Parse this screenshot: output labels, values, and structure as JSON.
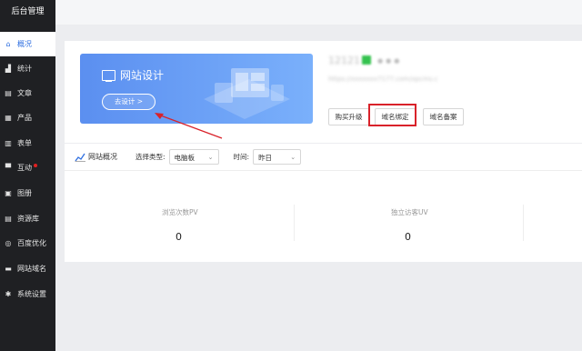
{
  "sidebar": {
    "title": "后台管理",
    "items": [
      {
        "label": "概况",
        "icon": "home-icon",
        "glyph": "⌂",
        "active": true
      },
      {
        "label": "统计",
        "icon": "stats-icon",
        "glyph": "▟"
      },
      {
        "label": "文章",
        "icon": "article-icon",
        "glyph": "▤"
      },
      {
        "label": "产品",
        "icon": "product-icon",
        "glyph": "▦"
      },
      {
        "label": "表单",
        "icon": "form-icon",
        "glyph": "▥"
      },
      {
        "label": "互动",
        "icon": "interaction-icon",
        "glyph": "▀",
        "badge": true
      },
      {
        "label": "图册",
        "icon": "gallery-icon",
        "glyph": "▣"
      },
      {
        "label": "资源库",
        "icon": "library-icon",
        "glyph": "▤"
      },
      {
        "label": "百度优化",
        "icon": "seo-icon",
        "glyph": "◎"
      },
      {
        "label": "网站域名",
        "icon": "domain-icon",
        "glyph": "▬"
      },
      {
        "label": "系统设置",
        "icon": "settings-icon",
        "glyph": "✱"
      }
    ]
  },
  "banner": {
    "title": "网站设计",
    "button": "去设计 >"
  },
  "site": {
    "name": "12121",
    "url": "https://xxxxxxx7177.com/xpcms.c"
  },
  "actions": {
    "buy_upgrade": "购买升级",
    "bind_domain": "域名绑定",
    "domain_record": "域名备案"
  },
  "overview": {
    "title": "网站概况",
    "type_label": "选择类型:",
    "type_value": "电脑板",
    "time_label": "时间:",
    "time_value": "昨日",
    "stats": [
      {
        "label": "浏览次数PV",
        "value": "0"
      },
      {
        "label": "独立访客UV",
        "value": "0"
      }
    ]
  },
  "colors": {
    "sidebar_bg": "#1f2023",
    "accent": "#2f6fe0",
    "highlight": "#d9222a",
    "status": "#34c24e"
  }
}
